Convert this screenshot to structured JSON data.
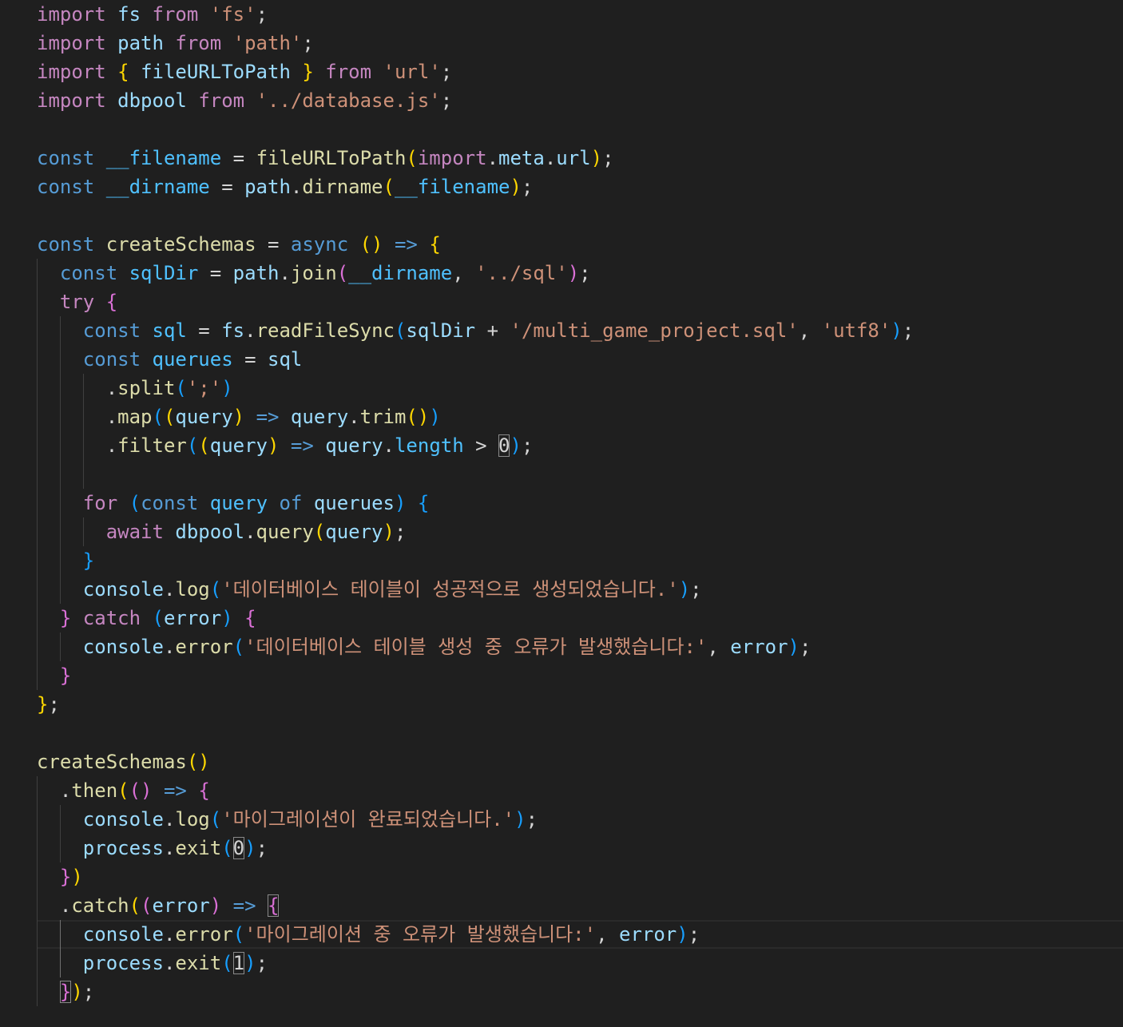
{
  "editor": {
    "background": "#1f1f1f",
    "colors": {
      "kw": "#c586c0",
      "st": "#569cd6",
      "var": "#9cdcfe",
      "fn": "#dcdcaa",
      "str": "#ce9178",
      "num": "#b5cea8",
      "op": "#d4d4d4",
      "cst": "#4fc1ff",
      "b1": "#ffd700",
      "b2": "#da70d6",
      "b3": "#179fff"
    },
    "lines": [
      {
        "indent": 0,
        "tokens": [
          [
            "kw",
            "import"
          ],
          [
            "op",
            " "
          ],
          [
            "var",
            "fs"
          ],
          [
            "op",
            " "
          ],
          [
            "kw",
            "from"
          ],
          [
            "op",
            " "
          ],
          [
            "str",
            "'fs'"
          ],
          [
            "op",
            ";"
          ]
        ]
      },
      {
        "indent": 0,
        "tokens": [
          [
            "kw",
            "import"
          ],
          [
            "op",
            " "
          ],
          [
            "var",
            "path"
          ],
          [
            "op",
            " "
          ],
          [
            "kw",
            "from"
          ],
          [
            "op",
            " "
          ],
          [
            "str",
            "'path'"
          ],
          [
            "op",
            ";"
          ]
        ]
      },
      {
        "indent": 0,
        "tokens": [
          [
            "kw",
            "import"
          ],
          [
            "op",
            " "
          ],
          [
            "b1",
            "{"
          ],
          [
            "op",
            " "
          ],
          [
            "var",
            "fileURLToPath"
          ],
          [
            "op",
            " "
          ],
          [
            "b1",
            "}"
          ],
          [
            "op",
            " "
          ],
          [
            "kw",
            "from"
          ],
          [
            "op",
            " "
          ],
          [
            "str",
            "'url'"
          ],
          [
            "op",
            ";"
          ]
        ]
      },
      {
        "indent": 0,
        "tokens": [
          [
            "kw",
            "import"
          ],
          [
            "op",
            " "
          ],
          [
            "var",
            "dbpool"
          ],
          [
            "op",
            " "
          ],
          [
            "kw",
            "from"
          ],
          [
            "op",
            " "
          ],
          [
            "str",
            "'../database.js'"
          ],
          [
            "op",
            ";"
          ]
        ]
      },
      {
        "indent": 0,
        "tokens": []
      },
      {
        "indent": 0,
        "tokens": [
          [
            "st",
            "const"
          ],
          [
            "op",
            " "
          ],
          [
            "cst",
            "__filename"
          ],
          [
            "op",
            " = "
          ],
          [
            "fn",
            "fileURLToPath"
          ],
          [
            "b1",
            "("
          ],
          [
            "kw",
            "import"
          ],
          [
            "op",
            "."
          ],
          [
            "var",
            "meta"
          ],
          [
            "op",
            "."
          ],
          [
            "var",
            "url"
          ],
          [
            "b1",
            ")"
          ],
          [
            "op",
            ";"
          ]
        ]
      },
      {
        "indent": 0,
        "tokens": [
          [
            "st",
            "const"
          ],
          [
            "op",
            " "
          ],
          [
            "cst",
            "__dirname"
          ],
          [
            "op",
            " = "
          ],
          [
            "var",
            "path"
          ],
          [
            "op",
            "."
          ],
          [
            "fn",
            "dirname"
          ],
          [
            "b1",
            "("
          ],
          [
            "cst",
            "__filename"
          ],
          [
            "b1",
            ")"
          ],
          [
            "op",
            ";"
          ]
        ]
      },
      {
        "indent": 0,
        "tokens": []
      },
      {
        "indent": 0,
        "tokens": [
          [
            "st",
            "const"
          ],
          [
            "op",
            " "
          ],
          [
            "fn",
            "createSchemas"
          ],
          [
            "op",
            " = "
          ],
          [
            "st",
            "async"
          ],
          [
            "op",
            " "
          ],
          [
            "b1",
            "()"
          ],
          [
            "op",
            " "
          ],
          [
            "st",
            "=>"
          ],
          [
            "op",
            " "
          ],
          [
            "b1",
            "{"
          ]
        ]
      },
      {
        "indent": 1,
        "tokens": [
          [
            "st",
            "const"
          ],
          [
            "op",
            " "
          ],
          [
            "cst",
            "sqlDir"
          ],
          [
            "op",
            " = "
          ],
          [
            "var",
            "path"
          ],
          [
            "op",
            "."
          ],
          [
            "fn",
            "join"
          ],
          [
            "b2",
            "("
          ],
          [
            "cst",
            "__dirname"
          ],
          [
            "op",
            ", "
          ],
          [
            "str",
            "'../sql'"
          ],
          [
            "b2",
            ")"
          ],
          [
            "op",
            ";"
          ]
        ]
      },
      {
        "indent": 1,
        "tokens": [
          [
            "kw",
            "try"
          ],
          [
            "op",
            " "
          ],
          [
            "b2",
            "{"
          ]
        ]
      },
      {
        "indent": 2,
        "tokens": [
          [
            "st",
            "const"
          ],
          [
            "op",
            " "
          ],
          [
            "cst",
            "sql"
          ],
          [
            "op",
            " = "
          ],
          [
            "var",
            "fs"
          ],
          [
            "op",
            "."
          ],
          [
            "fn",
            "readFileSync"
          ],
          [
            "b3",
            "("
          ],
          [
            "var",
            "sqlDir"
          ],
          [
            "op",
            " + "
          ],
          [
            "str",
            "'/multi_game_project.sql'"
          ],
          [
            "op",
            ", "
          ],
          [
            "str",
            "'utf8'"
          ],
          [
            "b3",
            ")"
          ],
          [
            "op",
            ";"
          ]
        ]
      },
      {
        "indent": 2,
        "tokens": [
          [
            "st",
            "const"
          ],
          [
            "op",
            " "
          ],
          [
            "cst",
            "querues"
          ],
          [
            "op",
            " = "
          ],
          [
            "var",
            "sql"
          ]
        ]
      },
      {
        "indent": 3,
        "tokens": [
          [
            "op",
            "."
          ],
          [
            "fn",
            "split"
          ],
          [
            "b3",
            "("
          ],
          [
            "str",
            "';'"
          ],
          [
            "b3",
            ")"
          ]
        ]
      },
      {
        "indent": 3,
        "tokens": [
          [
            "op",
            "."
          ],
          [
            "fn",
            "map"
          ],
          [
            "b3",
            "("
          ],
          [
            "b1",
            "("
          ],
          [
            "var",
            "query"
          ],
          [
            "b1",
            ")"
          ],
          [
            "op",
            " "
          ],
          [
            "st",
            "=>"
          ],
          [
            "op",
            " "
          ],
          [
            "var",
            "query"
          ],
          [
            "op",
            "."
          ],
          [
            "fn",
            "trim"
          ],
          [
            "b1",
            "()"
          ],
          [
            "b3",
            ")"
          ]
        ]
      },
      {
        "indent": 3,
        "tokens": [
          [
            "op",
            "."
          ],
          [
            "fn",
            "filter"
          ],
          [
            "b3",
            "("
          ],
          [
            "b1",
            "("
          ],
          [
            "var",
            "query"
          ],
          [
            "b1",
            ")"
          ],
          [
            "op",
            " "
          ],
          [
            "st",
            "=>"
          ],
          [
            "op",
            " "
          ],
          [
            "var",
            "query"
          ],
          [
            "op",
            "."
          ],
          [
            "cst",
            "length"
          ],
          [
            "op",
            " > "
          ],
          [
            "num",
            "0"
          ],
          [
            "b3",
            ")"
          ],
          [
            "op",
            ";"
          ]
        ]
      },
      {
        "indent": 3,
        "tokens": []
      },
      {
        "indent": 2,
        "tokens": [
          [
            "kw",
            "for"
          ],
          [
            "op",
            " "
          ],
          [
            "b3",
            "("
          ],
          [
            "st",
            "const"
          ],
          [
            "op",
            " "
          ],
          [
            "cst",
            "query"
          ],
          [
            "op",
            " "
          ],
          [
            "st",
            "of"
          ],
          [
            "op",
            " "
          ],
          [
            "var",
            "querues"
          ],
          [
            "b3",
            ")"
          ],
          [
            "op",
            " "
          ],
          [
            "b3",
            "{"
          ]
        ]
      },
      {
        "indent": 3,
        "tokens": [
          [
            "kw",
            "await"
          ],
          [
            "op",
            " "
          ],
          [
            "var",
            "dbpool"
          ],
          [
            "op",
            "."
          ],
          [
            "fn",
            "query"
          ],
          [
            "b1",
            "("
          ],
          [
            "var",
            "query"
          ],
          [
            "b1",
            ")"
          ],
          [
            "op",
            ";"
          ]
        ]
      },
      {
        "indent": 2,
        "tokens": [
          [
            "b3",
            "}"
          ]
        ]
      },
      {
        "indent": 2,
        "tokens": [
          [
            "var",
            "console"
          ],
          [
            "op",
            "."
          ],
          [
            "fn",
            "log"
          ],
          [
            "b3",
            "("
          ],
          [
            "str",
            "'데이터베이스 테이블이 성공적으로 생성되었습니다.'"
          ],
          [
            "b3",
            ")"
          ],
          [
            "op",
            ";"
          ]
        ]
      },
      {
        "indent": 1,
        "tokens": [
          [
            "b2",
            "}"
          ],
          [
            "op",
            " "
          ],
          [
            "kw",
            "catch"
          ],
          [
            "op",
            " "
          ],
          [
            "b3",
            "("
          ],
          [
            "var",
            "error"
          ],
          [
            "b3",
            ")"
          ],
          [
            "op",
            " "
          ],
          [
            "b2",
            "{"
          ]
        ]
      },
      {
        "indent": 2,
        "tokens": [
          [
            "var",
            "console"
          ],
          [
            "op",
            "."
          ],
          [
            "fn",
            "error"
          ],
          [
            "b3",
            "("
          ],
          [
            "str",
            "'데이터베이스 테이블 생성 중 오류가 발생했습니다:'"
          ],
          [
            "op",
            ", "
          ],
          [
            "var",
            "error"
          ],
          [
            "b3",
            ")"
          ],
          [
            "op",
            ";"
          ]
        ]
      },
      {
        "indent": 1,
        "tokens": [
          [
            "b2",
            "}"
          ]
        ]
      },
      {
        "indent": 0,
        "tokens": [
          [
            "b1",
            "}"
          ],
          [
            "op",
            ";"
          ]
        ]
      },
      {
        "indent": 0,
        "tokens": []
      },
      {
        "indent": 0,
        "tokens": [
          [
            "fn",
            "createSchemas"
          ],
          [
            "b1",
            "()"
          ]
        ]
      },
      {
        "indent": 1,
        "tokens": [
          [
            "op",
            "."
          ],
          [
            "fn",
            "then"
          ],
          [
            "b1",
            "("
          ],
          [
            "b2",
            "()"
          ],
          [
            "op",
            " "
          ],
          [
            "st",
            "=>"
          ],
          [
            "op",
            " "
          ],
          [
            "b2",
            "{"
          ]
        ]
      },
      {
        "indent": 2,
        "tokens": [
          [
            "var",
            "console"
          ],
          [
            "op",
            "."
          ],
          [
            "fn",
            "log"
          ],
          [
            "b3",
            "("
          ],
          [
            "str",
            "'마이그레이션이 완료되었습니다.'"
          ],
          [
            "b3",
            ")"
          ],
          [
            "op",
            ";"
          ]
        ]
      },
      {
        "indent": 2,
        "tokens": [
          [
            "var",
            "process"
          ],
          [
            "op",
            "."
          ],
          [
            "fn",
            "exit"
          ],
          [
            "b3",
            "("
          ],
          [
            "num",
            "0"
          ],
          [
            "b3",
            ")"
          ],
          [
            "op",
            ";"
          ]
        ]
      },
      {
        "indent": 1,
        "tokens": [
          [
            "b2",
            "}"
          ],
          [
            "b1",
            ")"
          ]
        ]
      },
      {
        "indent": 1,
        "tokens": [
          [
            "op",
            "."
          ],
          [
            "fn",
            "catch"
          ],
          [
            "b1",
            "("
          ],
          [
            "b2",
            "("
          ],
          [
            "var",
            "error"
          ],
          [
            "b2",
            ")"
          ],
          [
            "op",
            " "
          ],
          [
            "st",
            "=>"
          ],
          [
            "op",
            " "
          ],
          [
            "b2m",
            "{"
          ]
        ]
      },
      {
        "indent": 2,
        "current": true,
        "tokens": [
          [
            "var",
            "console"
          ],
          [
            "op",
            "."
          ],
          [
            "fn",
            "error"
          ],
          [
            "b3",
            "("
          ],
          [
            "str",
            "'마이그레이션 중 오류가 발생했습니다:'"
          ],
          [
            "op",
            ", "
          ],
          [
            "var",
            "error"
          ],
          [
            "b3",
            ")"
          ],
          [
            "op",
            ";"
          ]
        ]
      },
      {
        "indent": 2,
        "tokens": [
          [
            "var",
            "process"
          ],
          [
            "op",
            "."
          ],
          [
            "fn",
            "exit"
          ],
          [
            "b3",
            "("
          ],
          [
            "num",
            "1"
          ],
          [
            "b3",
            ")"
          ],
          [
            "op",
            ";"
          ]
        ]
      },
      {
        "indent": 1,
        "tokens": [
          [
            "b2m",
            "}"
          ],
          [
            "b1",
            ")"
          ],
          [
            "op",
            ";"
          ]
        ]
      }
    ]
  }
}
